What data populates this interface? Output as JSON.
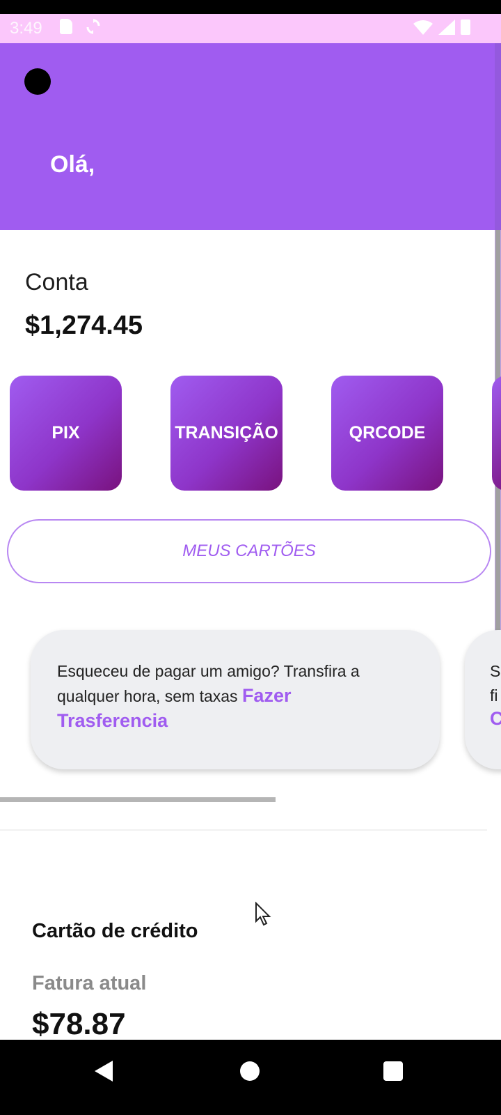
{
  "status_bar": {
    "time": "3:49",
    "icons": [
      "sd-card-icon",
      "sync-icon",
      "wifi-icon",
      "signal-icon",
      "battery-icon"
    ]
  },
  "header": {
    "greeting": "Olá,",
    "background_color": "#a05cf0"
  },
  "account": {
    "label": "Conta",
    "balance": "$1,274.45"
  },
  "actions": [
    {
      "label": "PIX"
    },
    {
      "label": "TRANSIÇÃO"
    },
    {
      "label": "QRCODE"
    }
  ],
  "cards_button": {
    "label": "MEUS CARTÕES"
  },
  "promos": [
    {
      "text": "Esqueceu de pagar um amigo? Transfira a qualquer hora, sem taxas",
      "link": "Fazer Trasferencia"
    },
    {
      "text_line1": "S",
      "text_line2": "fi",
      "link": "C"
    }
  ],
  "credit_card": {
    "title": "Cartão de crédito",
    "invoice_label": "Fatura atual",
    "invoice_value": "$78.87"
  },
  "nav_bar": {
    "icons": [
      "back-icon",
      "home-icon",
      "recents-icon"
    ]
  },
  "colors": {
    "accent": "#a05cf0",
    "accent_dark": "#79127e",
    "status_bar": "#fbc7fb",
    "card_bg": "#eeeff2"
  }
}
